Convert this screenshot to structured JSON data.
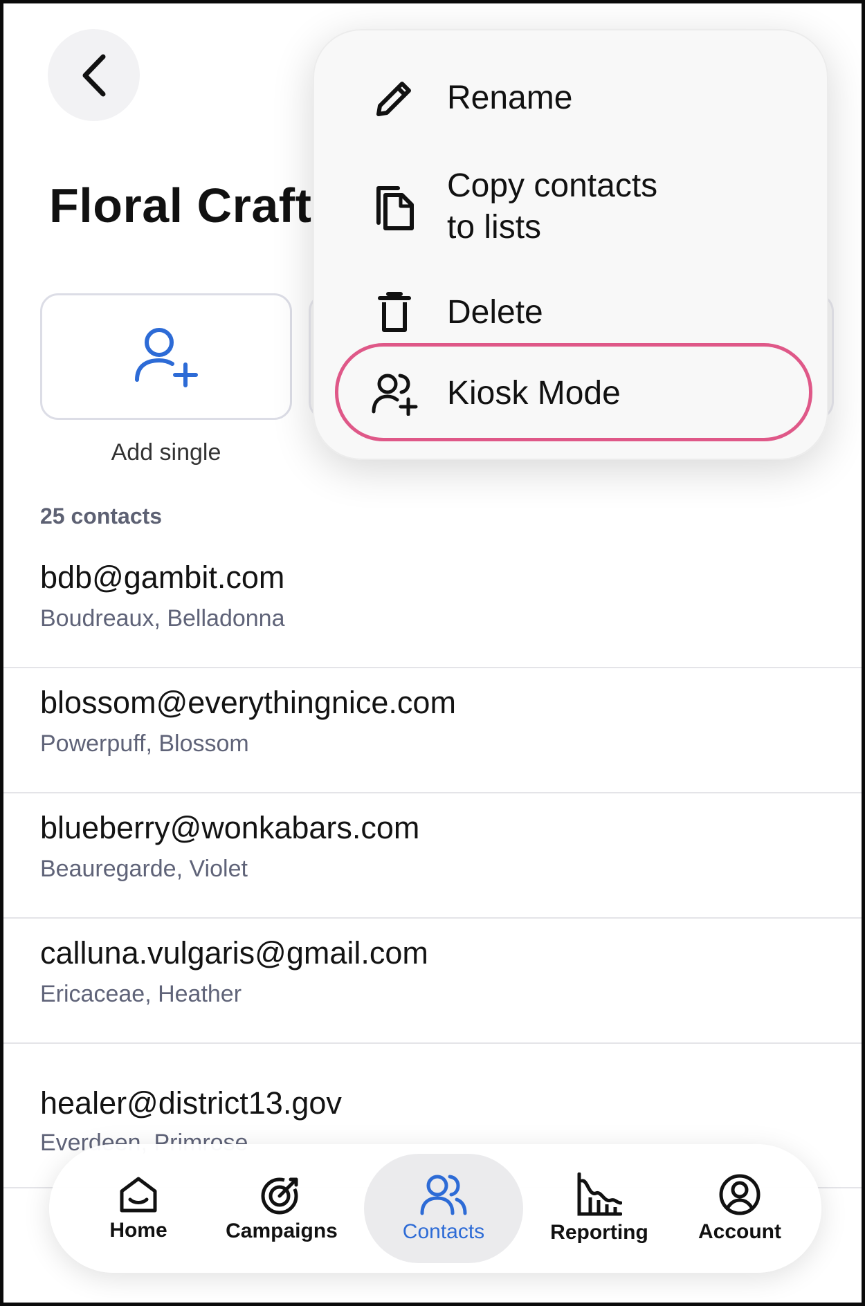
{
  "header": {
    "title": "Floral Craft"
  },
  "actions": [
    {
      "label": "Add single",
      "icon": "add-person-icon"
    }
  ],
  "contacts": {
    "count_label": "25 contacts",
    "items": [
      {
        "email": "bdb@gambit.com",
        "name": "Boudreaux, Belladonna"
      },
      {
        "email": "blossom@everythingnice.com",
        "name": "Powerpuff, Blossom"
      },
      {
        "email": "blueberry@wonkabars.com",
        "name": "Beauregarde, Violet"
      },
      {
        "email": "calluna.vulgaris@gmail.com",
        "name": "Ericaceae, Heather"
      },
      {
        "email": "healer@district13.gov",
        "name": "Everdeen, Primrose"
      }
    ]
  },
  "menu": {
    "items": [
      {
        "label": "Rename",
        "icon": "pencil-icon"
      },
      {
        "label": "Copy contacts\nto lists",
        "icon": "copy-icon"
      },
      {
        "label": "Delete",
        "icon": "trash-icon"
      },
      {
        "label": "Kiosk Mode",
        "icon": "kiosk-people-icon",
        "highlighted": true
      }
    ],
    "highlight_color": "#df5888"
  },
  "nav": {
    "active_color": "#2d6bd6",
    "items": [
      {
        "label": "Home",
        "icon": "home-icon"
      },
      {
        "label": "Campaigns",
        "icon": "target-icon"
      },
      {
        "label": "Contacts",
        "icon": "contacts-icon",
        "active": true
      },
      {
        "label": "Reporting",
        "icon": "chart-icon"
      },
      {
        "label": "Account",
        "icon": "account-icon"
      }
    ]
  }
}
